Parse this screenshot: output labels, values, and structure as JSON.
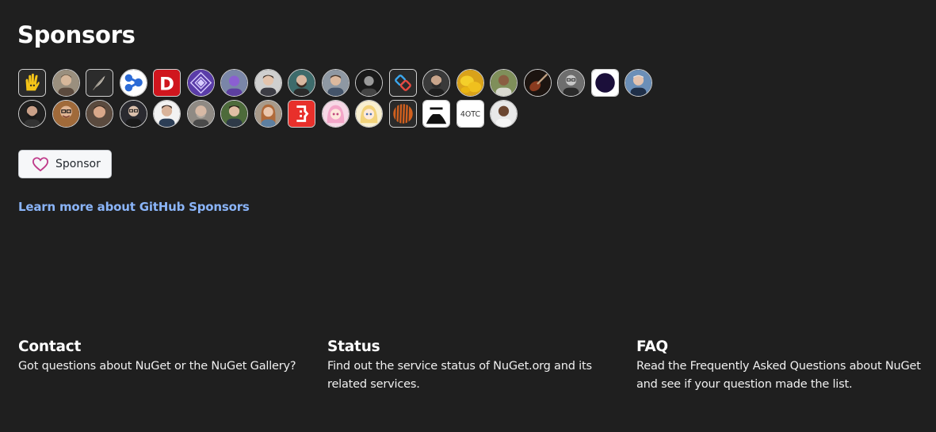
{
  "sponsors": {
    "title": "Sponsors",
    "button_label": "Sponsor",
    "learn_more": "Learn more about GitHub Sponsors"
  },
  "footer": {
    "contact": {
      "title": "Contact",
      "text": "Got questions about NuGet or the NuGet Gallery?"
    },
    "status": {
      "title": "Status",
      "text": "Find out the service status of NuGet.org and its related services."
    },
    "faq": {
      "title": "FAQ",
      "text": "Read the Frequently Asked Questions about NuGet and see if your question made the list."
    }
  },
  "avatar_logo_text": {
    "d_logo": "D",
    "fourotc": "4OTC"
  },
  "colors": {
    "background": "#1f1f1f",
    "link": "#8ab4f8",
    "button_bg": "#f6f7f9",
    "heart": "#bf3989"
  }
}
